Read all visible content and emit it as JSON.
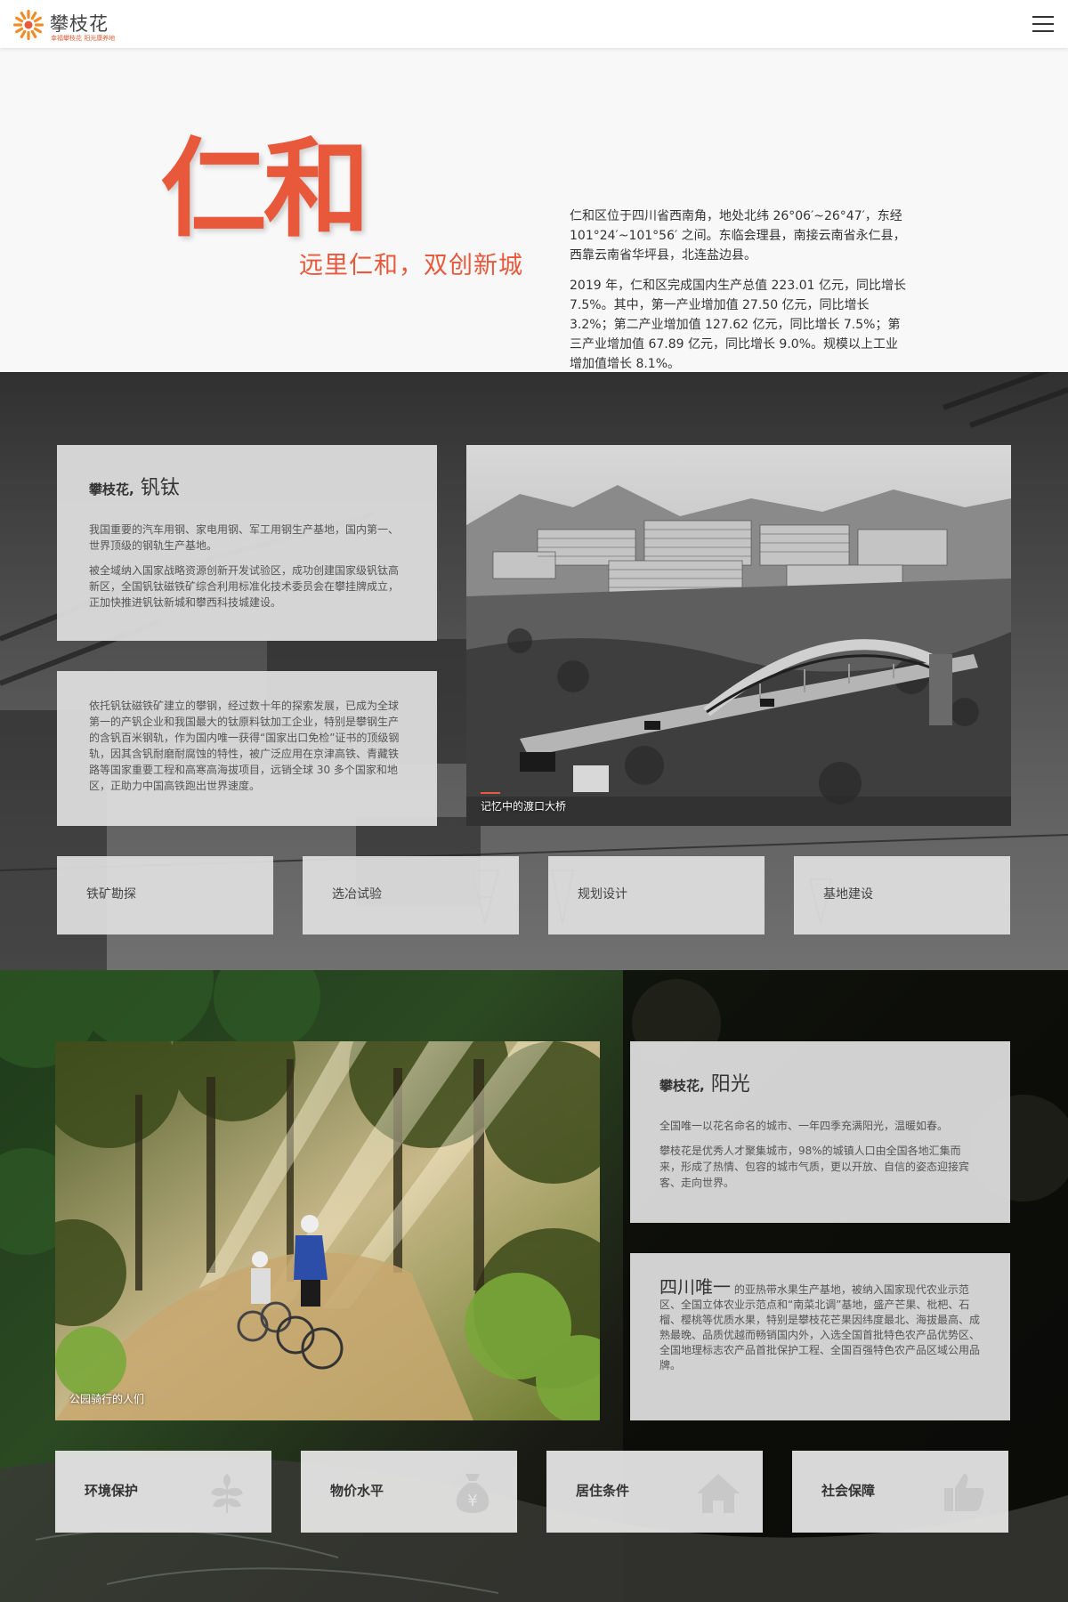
{
  "header": {
    "logo_name": "攀枝花",
    "logo_slogan": "幸福攀枝花 阳光康养地",
    "menu_icon": "hamburger-menu-icon"
  },
  "intro": {
    "title": "仁和",
    "subtitle": "远里仁和，双创新城",
    "para1": "仁和区位于四川省西南角，地处北纬 26°06′~26°47′，东经 101°24′~101°56′ 之间。东临会理县，南接云南省永仁县，西靠云南省华坪县，北连盐边县。",
    "para2": "2019 年，仁和区完成国内生产总值 223.01 亿元，同比增长 7.5%。其中，第一产业增加值 27.50 亿元，同比增长 3.2%；第二产业增加值 127.62 亿元，同比增长 7.5%；第三产业增加值 67.89 亿元，同比增长 9.0%。规模以上工业增加值增长 8.1%。"
  },
  "sec2": {
    "card_title_bold": "攀枝花,",
    "card_title": "钒钛",
    "card_p1": "我国重要的汽车用钢、家电用钢、军工用钢生产基地，国内第一、世界顶级的钢轨生产基地。",
    "card_p2": "被全域纳入国家战略资源创新开发试验区，成功创建国家级钒钛高新区，全国钒钛磁铁矿综合利用标准化技术委员会在攀挂牌成立，正加快推进钒钛新城和攀西科技城建设。",
    "card2_p": "依托钒钛磁铁矿建立的攀钢，经过数十年的探索发展，已成为全球第一的产钒企业和我国最大的钛原料钛加工企业，特别是攀钢生产的含钒百米钢轨，作为国内唯一获得“国家出口免检”证书的顶级钢轨，因其含钒耐磨耐腐蚀的特性，被广泛应用在京津高铁、青藏铁路等国家重要工程和高寒高海拔项目，远销全球 30 多个国家和地区，正助力中国高铁跑出世界速度。",
    "photo_caption": "记忆中的渡口大桥",
    "tabs": [
      "铁矿勘探",
      "选冶试验",
      "规划设计",
      "基地建设"
    ]
  },
  "sec3": {
    "photo_caption": "公园骑行的人们",
    "card_title_bold": "攀枝花,",
    "card_title": "阳光",
    "card_p1": "全国唯一以花名命名的城市、一年四季充满阳光，温暖如春。",
    "card_p2": "攀枝花是优秀人才聚集城市，98%的城镇人口由全国各地汇集而来，形成了热情、包容的城市气质，更以开放、自信的姿态迎接宾客、走向世界。",
    "card2_lead": "四川唯一",
    "card2_p": "的亚热带水果生产基地，被纳入国家现代农业示范区、全国立体农业示范点和“南菜北调”基地，盛产芒果、枇杷、石榴、樱桃等优质水果，特别是攀枝花芒果因纬度最北、海拔最高、成熟最晚、品质优越而畅销国内外，入选全国首批特色农产品优势区、全国地理标志农产品首批保护工程、全国百强特色农产品区域公用品牌。",
    "tabs": [
      {
        "label": "环境保护",
        "icon": "leaf-icon"
      },
      {
        "label": "物价水平",
        "icon": "money-bag-icon"
      },
      {
        "label": "居住条件",
        "icon": "house-icon"
      },
      {
        "label": "社会保障",
        "icon": "thumbs-up-icon"
      }
    ]
  },
  "colors": {
    "accent": "#e8593c",
    "card_bg": "#dedede"
  }
}
